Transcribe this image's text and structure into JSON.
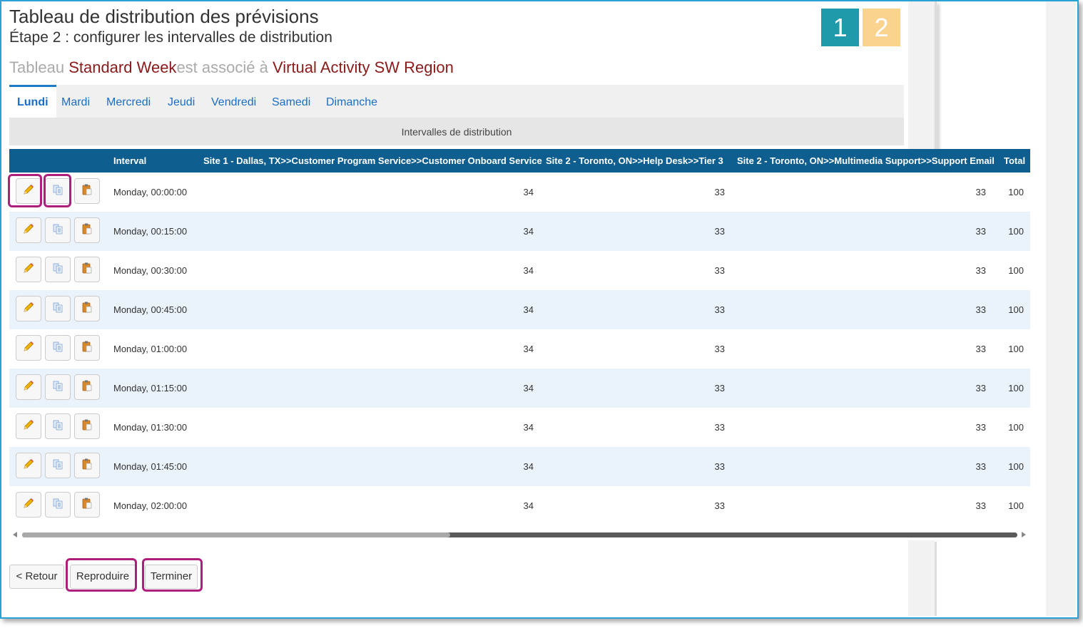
{
  "header": {
    "title": "Tableau de distribution des prévisions",
    "subtitle": "Étape 2 : configurer les intervalles de distribution",
    "assoc_prefix": "Tableau ",
    "table_name": "Standard Week",
    "assoc_middle": "est associé à ",
    "activity_name": "Virtual Activity SW Region"
  },
  "steps": [
    "1",
    "2"
  ],
  "tabs": [
    "Lundi",
    "Mardi",
    "Mercredi",
    "Jeudi",
    "Vendredi",
    "Samedi",
    "Dimanche"
  ],
  "active_tab": "Lundi",
  "section_title": "Intervalles de distribution",
  "table": {
    "columns": [
      "Interval",
      "Site 1 - Dallas, TX>>Customer Program Service>>Customer Onboard Service",
      "Site 2 - Toronto, ON>>Help Desk>>Tier 3",
      "Site 2 - Toronto, ON>>Multimedia Support>>Support Email",
      "Total"
    ],
    "rows": [
      {
        "interval": "Monday, 00:00:00",
        "c1": "34",
        "c2": "33",
        "c3": "33",
        "total": "100"
      },
      {
        "interval": "Monday, 00:15:00",
        "c1": "34",
        "c2": "33",
        "c3": "33",
        "total": "100"
      },
      {
        "interval": "Monday, 00:30:00",
        "c1": "34",
        "c2": "33",
        "c3": "33",
        "total": "100"
      },
      {
        "interval": "Monday, 00:45:00",
        "c1": "34",
        "c2": "33",
        "c3": "33",
        "total": "100"
      },
      {
        "interval": "Monday, 01:00:00",
        "c1": "34",
        "c2": "33",
        "c3": "33",
        "total": "100"
      },
      {
        "interval": "Monday, 01:15:00",
        "c1": "34",
        "c2": "33",
        "c3": "33",
        "total": "100"
      },
      {
        "interval": "Monday, 01:30:00",
        "c1": "34",
        "c2": "33",
        "c3": "33",
        "total": "100"
      },
      {
        "interval": "Monday, 01:45:00",
        "c1": "34",
        "c2": "33",
        "c3": "33",
        "total": "100"
      },
      {
        "interval": "Monday, 02:00:00",
        "c1": "34",
        "c2": "33",
        "c3": "33",
        "total": "100"
      }
    ]
  },
  "buttons": {
    "back": "< Retour",
    "reproduce": "Reproduire",
    "finish": "Terminer"
  },
  "colors": {
    "accent_blue": "#1a6ec8",
    "header_navy": "#0e5e8f",
    "step1": "#1f9aab",
    "step2": "#fad48f",
    "highlight": "#b01e7d",
    "dark_red": "#8b1a1a"
  },
  "icons": {
    "edit": "pencil-icon",
    "copy": "copy-icon",
    "paste": "paste-icon"
  }
}
